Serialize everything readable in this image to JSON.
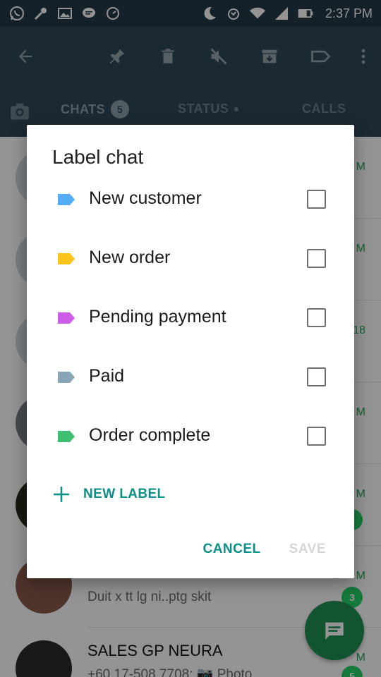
{
  "status_bar": {
    "time": "2:37 PM",
    "left_icons": [
      "whatsapp-icon",
      "wrench-icon",
      "gallery-icon",
      "message-icon",
      "speed-icon"
    ],
    "right_icons": [
      "moon-icon",
      "alarm-icon",
      "wifi-icon",
      "signal-icon",
      "battery-icon"
    ]
  },
  "toolbar": {
    "icons": [
      "back-arrow-icon",
      "pin-icon",
      "delete-icon",
      "mute-icon",
      "archive-icon",
      "label-icon",
      "more-vert-icon"
    ]
  },
  "tabs": {
    "chats": "CHATS",
    "chats_badge": "5",
    "status": "STATUS",
    "calls": "CALLS"
  },
  "chat_list": {
    "rows": [
      {
        "time": "M"
      },
      {
        "time": "M"
      },
      {
        "time": "18"
      },
      {
        "time": "M"
      },
      {
        "time": "M"
      },
      {
        "time": "M",
        "message": "Duit x tt lg ni..ptg skit",
        "unread": "3"
      },
      {
        "time": "M",
        "name": "SALES GP NEURA",
        "message": "+60 17-508 7708: 📷 Photo",
        "unread": "5"
      }
    ]
  },
  "dialog": {
    "title": "Label chat",
    "labels": [
      {
        "text": "New customer",
        "color": "#55aef5",
        "checked": false
      },
      {
        "text": "New order",
        "color": "#fcc419",
        "checked": false
      },
      {
        "text": "Pending payment",
        "color": "#cc5de8",
        "checked": false
      },
      {
        "text": "Paid",
        "color": "#87a5b6",
        "checked": false
      },
      {
        "text": "Order complete",
        "color": "#3fbf72",
        "checked": false
      }
    ],
    "new_label": "NEW LABEL",
    "cancel": "CANCEL",
    "save": "SAVE"
  },
  "colors": {
    "accent": "#0b8f86",
    "appbar": "#2e4756",
    "fab": "#1f8f53"
  }
}
